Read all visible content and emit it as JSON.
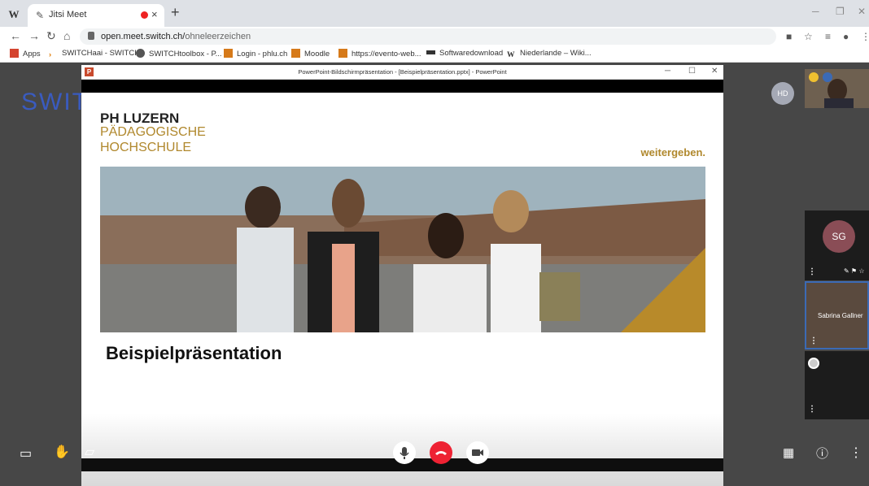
{
  "browser": {
    "tab_title": "Jitsi Meet",
    "url_host": "open.meet.switch.ch/",
    "url_path": "ohneleerzeichen",
    "bookmarks": [
      "Apps",
      "SWITCHaai - SWITCH",
      "SWITCHtoolbox - P...",
      "Login - phlu.ch",
      "Moodle",
      "https://evento-web...",
      "Softwaredownload",
      "Niederlande – Wiki..."
    ]
  },
  "meet": {
    "logo": "SWITCH",
    "window_title": "PowerPoint-Bildschirmpräsentation - [Beispielpräsentation.pptx] - PowerPoint",
    "slide": {
      "brand_1": "PH LUZERN",
      "brand_2": "PÄDAGOGISCHE",
      "brand_3": "HOCHSCHULE",
      "tagline": "weitergeben.",
      "heading": "Beispielpräsentation"
    },
    "participants": {
      "hd_initials": "HD",
      "sg_initials": "SG",
      "selected_name": "Sabrina Gallner"
    }
  },
  "colors": {
    "accent": "#b0882d",
    "hangup": "#e22233",
    "selected": "#3b6ab5"
  }
}
